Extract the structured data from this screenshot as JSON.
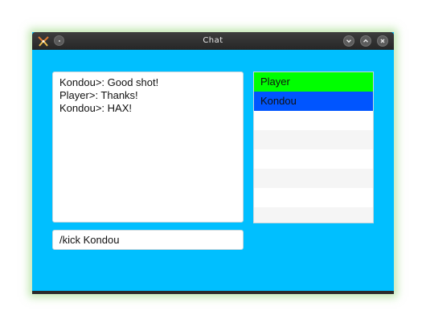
{
  "window": {
    "title": "Chat",
    "client_background": "#00bfff"
  },
  "chat": {
    "messages": [
      "Kondou>: Good shot!",
      "Player>: Thanks!",
      "Kondou>: HAX!"
    ],
    "input_value": "/kick Kondou"
  },
  "players": {
    "items": [
      {
        "name": "Player",
        "color": "#00ff00"
      },
      {
        "name": "Kondou",
        "color": "#0055ff"
      }
    ]
  }
}
